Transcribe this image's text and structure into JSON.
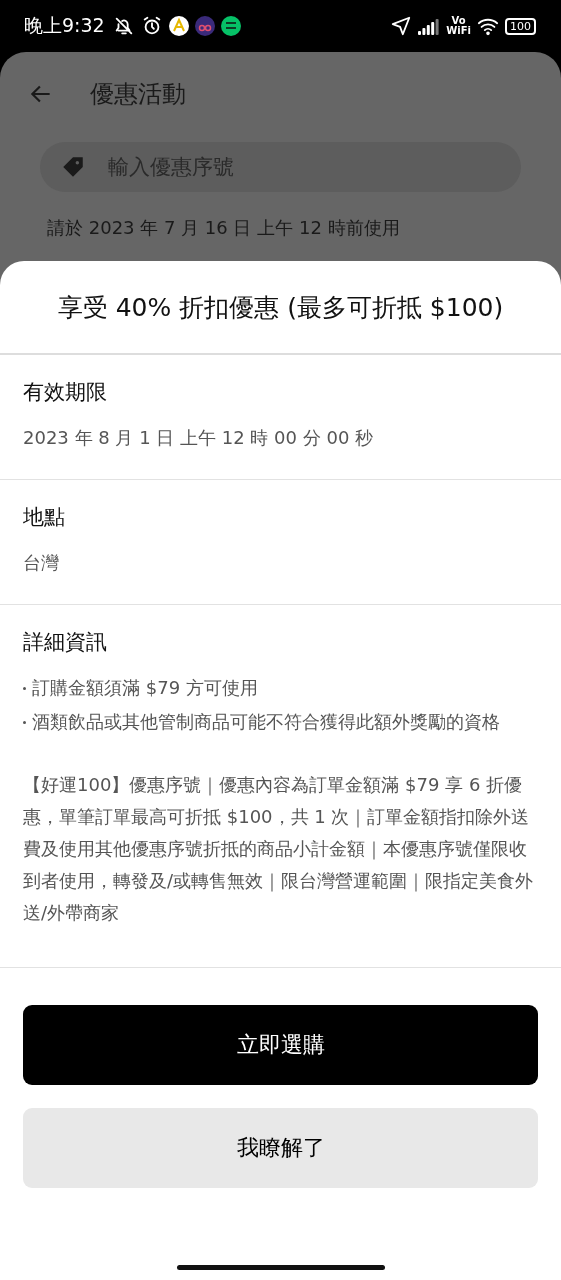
{
  "status_bar": {
    "time": "晚上9:32",
    "vowifi": [
      "Vo",
      "WiFi"
    ],
    "battery": "100"
  },
  "background_page": {
    "title": "優惠活動",
    "search": {
      "placeholder": "輸入優惠序號"
    },
    "note": "請於 2023 年 7 月 16 日 上午 12 時前使用"
  },
  "sheet": {
    "title": "享受 40% 折扣優惠 (最多可折抵 $100)",
    "sections": [
      {
        "heading": "有效期限",
        "lines": [
          "2023 年 8 月 1 日 上午 12 時 00 分 00 秒"
        ]
      },
      {
        "heading": "地點",
        "lines": [
          "台灣"
        ]
      },
      {
        "heading": "詳細資訊",
        "bullets": [
          "訂購金額須滿 $79 方可使用",
          "酒類飲品或其他管制商品可能不符合獲得此額外獎勵的資格"
        ],
        "paragraph": "【好運100】優惠序號｜優惠內容為訂單金額滿 $79 享 6 折優惠，單筆訂單最高可折抵 $100，共 1 次｜訂單金額指扣除外送費及使用其他優惠序號折抵的商品小計金額｜本優惠序號僅限收到者使用，轉發及/或轉售無效｜限台灣營運範圍｜限指定美食外送/外帶商家"
      }
    ],
    "buttons": [
      {
        "label": "立即選購",
        "kind": "primary"
      },
      {
        "label": "我瞭解了",
        "kind": "secondary"
      }
    ]
  }
}
